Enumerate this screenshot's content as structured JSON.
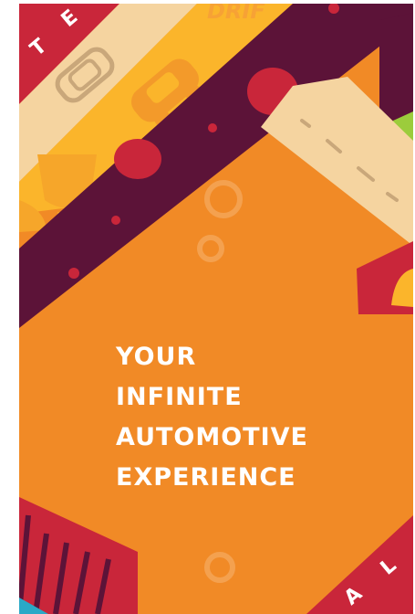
{
  "app": {
    "headline": [
      "YOUR",
      "INFINITE",
      "AUTOMOTIVE",
      "EXPERIENCE"
    ],
    "banner_word": "DRIF",
    "corner_letters": {
      "top_left_1": "T",
      "top_left_2": "E",
      "bottom_right_1": "A",
      "bottom_right_2": "L"
    }
  },
  "icons": [
    "car-icon",
    "trophy-icon",
    "road-icon",
    "tire-icon",
    "flame-icon"
  ],
  "colors": {
    "background": "#f18a26",
    "maroon": "#5c1338",
    "red": "#c9263a",
    "cream": "#f5d4a0",
    "yellow": "#fbb52b",
    "lime": "#9ccc3c",
    "teal": "#2aa9c7",
    "text": "#ffffff"
  }
}
